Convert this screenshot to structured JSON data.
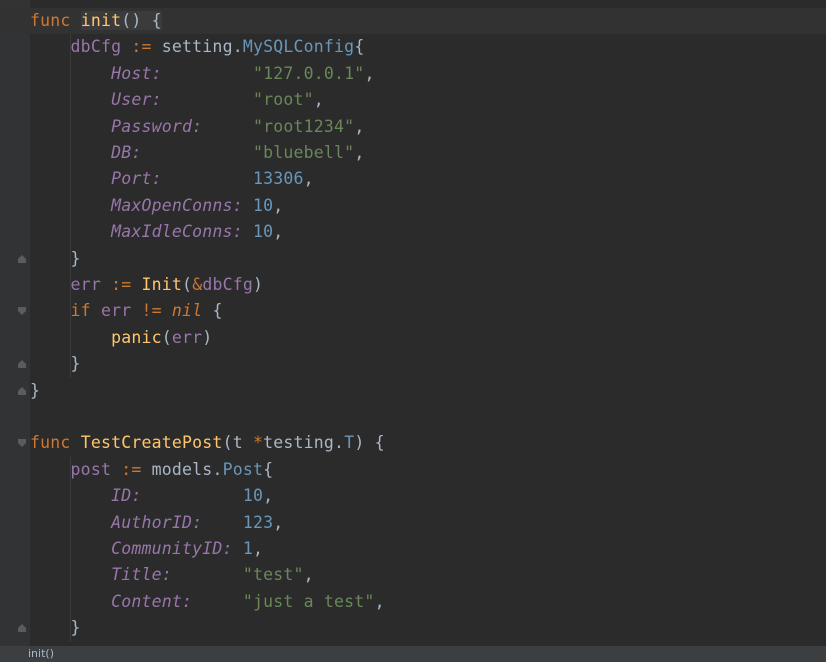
{
  "editor": {
    "lines": [
      {
        "tokens": [
          {
            "t": "func",
            "c": "kw"
          },
          {
            "t": " ",
            "c": "pl"
          },
          {
            "t": "init",
            "c": "fn"
          },
          {
            "t": "() {",
            "c": "pl"
          }
        ]
      },
      {
        "tokens": [
          {
            "t": "    ",
            "c": "pl"
          },
          {
            "t": "dbCfg",
            "c": "id"
          },
          {
            "t": " := ",
            "c": "op"
          },
          {
            "t": "setting.",
            "c": "pl"
          },
          {
            "t": "MySQLConfig",
            "c": "tp"
          },
          {
            "t": "{",
            "c": "pl"
          }
        ]
      },
      {
        "tokens": [
          {
            "t": "        ",
            "c": "pl"
          },
          {
            "t": "Host:",
            "c": "fld"
          },
          {
            "t": "         ",
            "c": "pl"
          },
          {
            "t": "\"127.0.0.1\"",
            "c": "str"
          },
          {
            "t": ",",
            "c": "pl"
          }
        ]
      },
      {
        "tokens": [
          {
            "t": "        ",
            "c": "pl"
          },
          {
            "t": "User:",
            "c": "fld"
          },
          {
            "t": "         ",
            "c": "pl"
          },
          {
            "t": "\"root\"",
            "c": "str"
          },
          {
            "t": ",",
            "c": "pl"
          }
        ]
      },
      {
        "tokens": [
          {
            "t": "        ",
            "c": "pl"
          },
          {
            "t": "Password:",
            "c": "fld"
          },
          {
            "t": "     ",
            "c": "pl"
          },
          {
            "t": "\"root1234\"",
            "c": "str"
          },
          {
            "t": ",",
            "c": "pl"
          }
        ]
      },
      {
        "tokens": [
          {
            "t": "        ",
            "c": "pl"
          },
          {
            "t": "DB:",
            "c": "fld"
          },
          {
            "t": "           ",
            "c": "pl"
          },
          {
            "t": "\"bluebell\"",
            "c": "str"
          },
          {
            "t": ",",
            "c": "pl"
          }
        ]
      },
      {
        "tokens": [
          {
            "t": "        ",
            "c": "pl"
          },
          {
            "t": "Port:",
            "c": "fld"
          },
          {
            "t": "         ",
            "c": "pl"
          },
          {
            "t": "13306",
            "c": "num"
          },
          {
            "t": ",",
            "c": "pl"
          }
        ]
      },
      {
        "tokens": [
          {
            "t": "        ",
            "c": "pl"
          },
          {
            "t": "MaxOpenConns:",
            "c": "fld"
          },
          {
            "t": " ",
            "c": "pl"
          },
          {
            "t": "10",
            "c": "num"
          },
          {
            "t": ",",
            "c": "pl"
          }
        ]
      },
      {
        "tokens": [
          {
            "t": "        ",
            "c": "pl"
          },
          {
            "t": "MaxIdleConns:",
            "c": "fld"
          },
          {
            "t": " ",
            "c": "pl"
          },
          {
            "t": "10",
            "c": "num"
          },
          {
            "t": ",",
            "c": "pl"
          }
        ]
      },
      {
        "tokens": [
          {
            "t": "    }",
            "c": "pl"
          }
        ]
      },
      {
        "tokens": [
          {
            "t": "    ",
            "c": "pl"
          },
          {
            "t": "err",
            "c": "id"
          },
          {
            "t": " := ",
            "c": "op"
          },
          {
            "t": "Init",
            "c": "fn"
          },
          {
            "t": "(",
            "c": "pl"
          },
          {
            "t": "&",
            "c": "op"
          },
          {
            "t": "dbCfg",
            "c": "id"
          },
          {
            "t": ")",
            "c": "pl"
          }
        ]
      },
      {
        "tokens": [
          {
            "t": "    ",
            "c": "pl"
          },
          {
            "t": "if",
            "c": "kw"
          },
          {
            "t": " ",
            "c": "pl"
          },
          {
            "t": "err",
            "c": "id"
          },
          {
            "t": " != ",
            "c": "op"
          },
          {
            "t": "nil",
            "c": "kw ital"
          },
          {
            "t": " {",
            "c": "pl"
          }
        ]
      },
      {
        "tokens": [
          {
            "t": "        ",
            "c": "pl"
          },
          {
            "t": "panic",
            "c": "fn"
          },
          {
            "t": "(",
            "c": "pl"
          },
          {
            "t": "err",
            "c": "id"
          },
          {
            "t": ")",
            "c": "pl"
          }
        ]
      },
      {
        "tokens": [
          {
            "t": "    }",
            "c": "pl"
          }
        ]
      },
      {
        "tokens": [
          {
            "t": "}",
            "c": "pl"
          }
        ]
      },
      {
        "tokens": []
      },
      {
        "tokens": [
          {
            "t": "func",
            "c": "kw"
          },
          {
            "t": " ",
            "c": "pl"
          },
          {
            "t": "TestCreatePost",
            "c": "fn"
          },
          {
            "t": "(t ",
            "c": "pl"
          },
          {
            "t": "*",
            "c": "op"
          },
          {
            "t": "testing.",
            "c": "pl"
          },
          {
            "t": "T",
            "c": "tp"
          },
          {
            "t": ") {",
            "c": "pl"
          }
        ]
      },
      {
        "tokens": [
          {
            "t": "    ",
            "c": "pl"
          },
          {
            "t": "post",
            "c": "id"
          },
          {
            "t": " := ",
            "c": "op"
          },
          {
            "t": "models.",
            "c": "pl"
          },
          {
            "t": "Post",
            "c": "tp"
          },
          {
            "t": "{",
            "c": "pl"
          }
        ]
      },
      {
        "tokens": [
          {
            "t": "        ",
            "c": "pl"
          },
          {
            "t": "ID:",
            "c": "fld"
          },
          {
            "t": "          ",
            "c": "pl"
          },
          {
            "t": "10",
            "c": "num"
          },
          {
            "t": ",",
            "c": "pl"
          }
        ]
      },
      {
        "tokens": [
          {
            "t": "        ",
            "c": "pl"
          },
          {
            "t": "AuthorID:",
            "c": "fld"
          },
          {
            "t": "    ",
            "c": "pl"
          },
          {
            "t": "123",
            "c": "num"
          },
          {
            "t": ",",
            "c": "pl"
          }
        ]
      },
      {
        "tokens": [
          {
            "t": "        ",
            "c": "pl"
          },
          {
            "t": "CommunityID:",
            "c": "fld"
          },
          {
            "t": " ",
            "c": "pl"
          },
          {
            "t": "1",
            "c": "num"
          },
          {
            "t": ",",
            "c": "pl"
          }
        ]
      },
      {
        "tokens": [
          {
            "t": "        ",
            "c": "pl"
          },
          {
            "t": "Title:",
            "c": "fld"
          },
          {
            "t": "       ",
            "c": "pl"
          },
          {
            "t": "\"test\"",
            "c": "str"
          },
          {
            "t": ",",
            "c": "pl"
          }
        ]
      },
      {
        "tokens": [
          {
            "t": "        ",
            "c": "pl"
          },
          {
            "t": "Content:",
            "c": "fld"
          },
          {
            "t": "     ",
            "c": "pl"
          },
          {
            "t": "\"just a test\"",
            "c": "str"
          },
          {
            "t": ",",
            "c": "pl"
          }
        ]
      },
      {
        "tokens": [
          {
            "t": "    }",
            "c": "pl"
          }
        ]
      }
    ],
    "fold_markers": [
      {
        "line": 0,
        "kind": "open"
      },
      {
        "line": 9,
        "kind": "close"
      },
      {
        "line": 11,
        "kind": "open"
      },
      {
        "line": 13,
        "kind": "close"
      },
      {
        "line": 14,
        "kind": "close"
      },
      {
        "line": 16,
        "kind": "open"
      },
      {
        "line": 23,
        "kind": "close"
      }
    ],
    "current_line": 0
  },
  "statusbar": {
    "breadcrumb": "init()"
  },
  "colors": {
    "background": "#2b2b2b",
    "keyword": "#cc7832",
    "function": "#ffc66d",
    "string": "#6a8759",
    "number": "#6897bb",
    "field": "#9876aa"
  }
}
